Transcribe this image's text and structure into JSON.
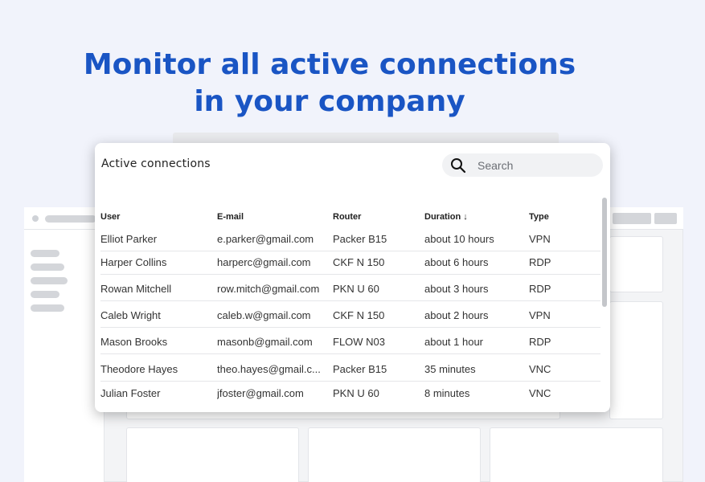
{
  "headline": {
    "line1": "Monitor all active connections",
    "line2": "in your company"
  },
  "panel": {
    "title": "Active connections",
    "search_placeholder": "Search"
  },
  "table": {
    "headers": {
      "user": "User",
      "email": "E-mail",
      "router": "Router",
      "duration": "Duration ↓",
      "type": "Type"
    },
    "rows": [
      {
        "user": "Elliot Parker",
        "email": "e.parker@gmail.com",
        "router": "Packer B15",
        "duration": "about 10 hours",
        "type": "VPN"
      },
      {
        "user": "Harper Collins",
        "email": "harperc@gmail.com",
        "router": "CKF N 150",
        "duration": "about 6 hours",
        "type": "RDP"
      },
      {
        "user": "Rowan Mitchell",
        "email": "row.mitch@gmail.com",
        "router": "PKN U 60",
        "duration": "about 3 hours",
        "type": "RDP"
      },
      {
        "user": "Caleb Wright",
        "email": "caleb.w@gmail.com",
        "router": "CKF N 150",
        "duration": "about 2 hours",
        "type": "VPN"
      },
      {
        "user": "Mason Brooks",
        "email": "masonb@gmail.com",
        "router": "FLOW N03",
        "duration": "about 1 hour",
        "type": "RDP"
      },
      {
        "user": "Theodore Hayes",
        "email": "theo.hayes@gmail.c...",
        "router": "Packer B15",
        "duration": "35 minutes",
        "type": "VNC"
      },
      {
        "user": "Julian Foster",
        "email": "jfoster@gmail.com",
        "router": "PKN U 60",
        "duration": "8 minutes",
        "type": "VNC"
      }
    ]
  },
  "colors": {
    "accent": "#1a55c4",
    "background": "#f1f3fb"
  }
}
